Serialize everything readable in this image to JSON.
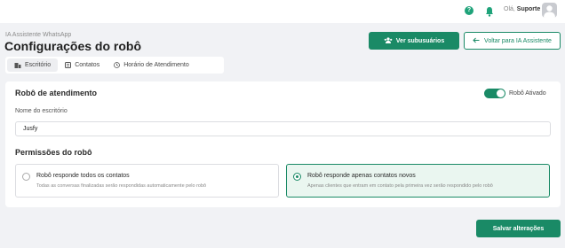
{
  "header": {
    "greeting_prefix": "Olá,",
    "user_name": "Suporte",
    "help_glyph": "?",
    "icons": [
      "help-icon",
      "bell-icon",
      "avatar"
    ]
  },
  "page": {
    "breadcrumb": "IA Assistente WhatsApp",
    "title": "Configurações do robô"
  },
  "actions": {
    "subaccounts_label": "Ver subusuários",
    "back_label": "Voltar para IA Assistente"
  },
  "tabs": [
    {
      "label": "Escritório",
      "icon": "building-icon",
      "active": true
    },
    {
      "label": "Contatos",
      "icon": "contacts-icon",
      "active": false
    },
    {
      "label": "Horário de Atendimento",
      "icon": "clock-icon",
      "active": false
    }
  ],
  "bot": {
    "section_title": "Robô de atendimento",
    "toggle_label": "Robô Ativado",
    "toggle_on": true,
    "office_label": "Nome do escritório",
    "office_value": "Jusfy"
  },
  "permissions": {
    "title": "Permissões do robô",
    "options": [
      {
        "title": "Robô responde todos os contatos",
        "description": "Todas as conversas finalizadas serão respondidas automaticamente pelo robô",
        "selected": false
      },
      {
        "title": "Robô responde apenas contatos novos",
        "description": "Apenas clientes que entram em contato pela primeira vez serão respondido pelo robô",
        "selected": true
      }
    ]
  },
  "footer": {
    "save_label": "Salvar alterações"
  },
  "colors": {
    "accent": "#1a8a66",
    "background": "#f1f2f5"
  }
}
